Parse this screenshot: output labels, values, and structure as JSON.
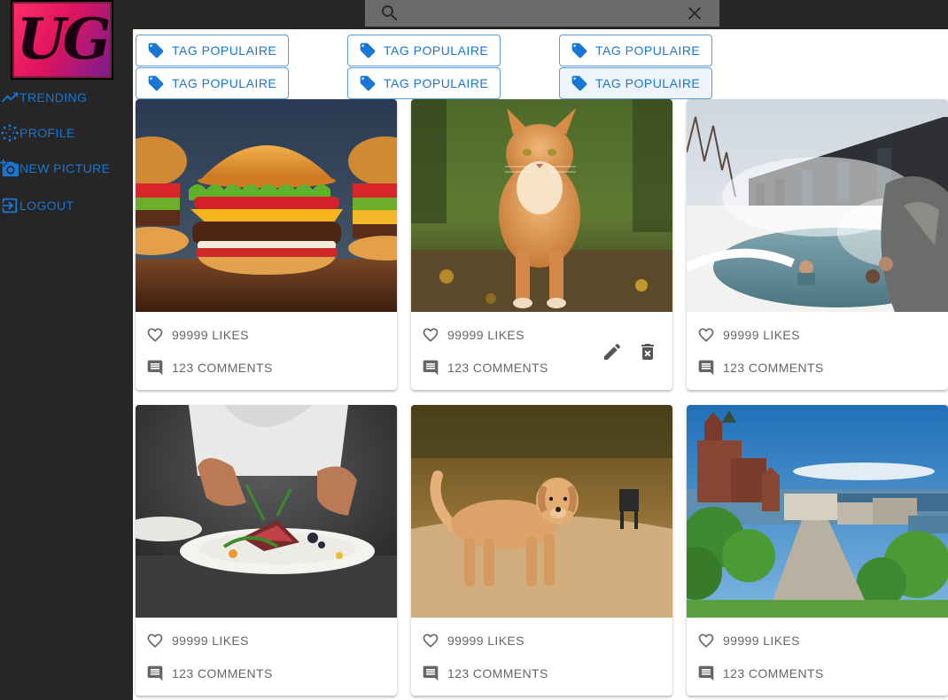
{
  "app": {
    "logo_text": "UG"
  },
  "nav": [
    {
      "label": "TRENDING",
      "icon": "trending-up-icon"
    },
    {
      "label": "PROFILE",
      "icon": "profile-burst-icon"
    },
    {
      "label": "NEW PICTURE",
      "icon": "camera-icon"
    },
    {
      "label": "LOGOUT",
      "icon": "logout-icon"
    }
  ],
  "search": {
    "placeholder": "",
    "value": ""
  },
  "tags": [
    {
      "label": "TAG POPULAIRE"
    },
    {
      "label": "TAG POPULAIRE"
    },
    {
      "label": "TAG POPULAIRE"
    },
    {
      "label": "TAG POPULAIRE"
    },
    {
      "label": "TAG POPULAIRE"
    },
    {
      "label": "TAG POPULAIRE"
    }
  ],
  "posts": [
    {
      "image": "burger",
      "likes": "99999 LIKES",
      "comments": "123 COMMENTS"
    },
    {
      "image": "cat",
      "likes": "99999 LIKES",
      "comments": "123 COMMENTS",
      "editable": true
    },
    {
      "image": "hot-spring-spa",
      "likes": "99999 LIKES",
      "comments": "123 COMMENTS"
    },
    {
      "image": "chef-plating",
      "likes": "99999 LIKES",
      "comments": "123 COMMENTS"
    },
    {
      "image": "dog",
      "likes": "99999 LIKES",
      "comments": "123 COMMENTS"
    },
    {
      "image": "quebec-city",
      "likes": "99999 LIKES",
      "comments": "123 COMMENTS"
    }
  ],
  "colors": {
    "sidebar_bg": "#262626",
    "accent": "#1976d2",
    "search_bg": "#6b6b6b"
  }
}
